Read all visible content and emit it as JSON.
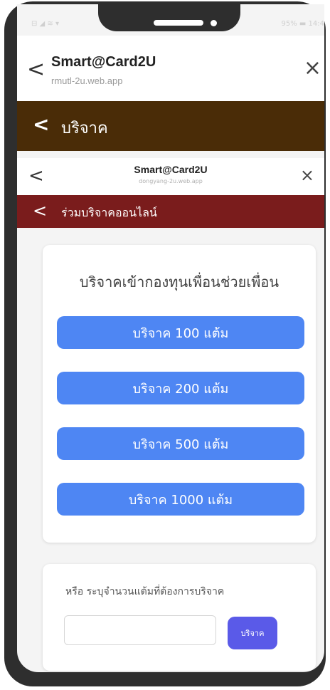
{
  "status_bar": {
    "left": "⊟ ◢ ≋ ▾",
    "right": "95% ▬ 14:4"
  },
  "browser_bar": {
    "title": "Smart@Card2U",
    "url": "rmutl-2u.web.app",
    "back_glyph": "<",
    "close_glyph": "×"
  },
  "app_header": {
    "title": "บริจาค",
    "back_glyph": "<"
  },
  "inner_browser_bar": {
    "title": "Smart@Card2U",
    "url": "dongyang-2u.web.app",
    "back_glyph": "<",
    "close_glyph": "×"
  },
  "inner_header": {
    "title": "ร่วมบริจาคออนไลน์",
    "back_glyph": "<"
  },
  "donation_card": {
    "title": "บริจาคเข้ากองทุนเพื่อนช่วยเพื่อน",
    "buttons": [
      "บริจาค 100 แต้ม",
      "บริจาค 200 แต้ม",
      "บริจาค 500 แต้ม",
      "บริจาค 1000 แต้ม"
    ]
  },
  "custom_card": {
    "label": "หรือ ระบุจำนวนแต้มที่ต้องการบริจาค",
    "input_value": "",
    "submit_label": "บริจาค"
  },
  "colors": {
    "app_header_bg": "#4a2c07",
    "inner_header_bg": "#7a1c1c",
    "donate_button_bg": "#4e86f3",
    "submit_button_bg": "#5a5ae8"
  }
}
